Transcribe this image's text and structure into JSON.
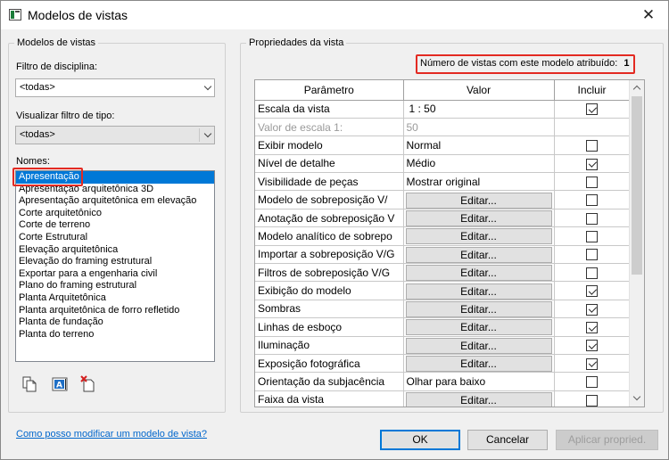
{
  "window": {
    "title": "Modelos de vistas",
    "close_glyph": "✕"
  },
  "left_panel": {
    "legend": "Modelos de vistas",
    "discipline_filter": {
      "label": "Filtro de disciplina:",
      "value": "<todas>"
    },
    "type_filter": {
      "label": "Visualizar filtro de tipo:",
      "value": "<todas>"
    },
    "names_label": "Nomes:",
    "names": [
      "Apresentação",
      "Apresentação arquitetônica 3D",
      "Apresentação arquitetônica em elevação",
      "Corte arquitetônico",
      "Corte de terreno",
      "Corte Estrutural",
      "Elevação arquitetônica",
      "Elevação do framing estrutural",
      "Exportar para a engenharia civil",
      "Plano do framing estrutural",
      "Planta Arquitetônica",
      "Planta arquitetônica de forro refletido",
      "Planta de fundação",
      "Planta do terreno"
    ],
    "selected_index": 0,
    "tool_icons": [
      "duplicate-icon",
      "rename-icon",
      "delete-icon"
    ],
    "tool_glyphs": {
      "rename": "A"
    }
  },
  "right_panel": {
    "legend": "Propriedades da vista",
    "count_label": "Número de vistas com este modelo atribuído:",
    "count_value": "1",
    "columns": {
      "param": "Parâmetro",
      "value": "Valor",
      "include": "Incluir"
    },
    "rows": [
      {
        "param": "Escala da vista",
        "value": "1 : 50",
        "type": "text",
        "include": true
      },
      {
        "param": "Valor de escala    1:",
        "value": "50",
        "type": "text",
        "include": null,
        "disabled": true
      },
      {
        "param": "Exibir modelo",
        "value": "Normal",
        "type": "text",
        "include": false
      },
      {
        "param": "Nível de detalhe",
        "value": "Médio",
        "type": "text",
        "include": true
      },
      {
        "param": "Visibilidade de peças",
        "value": "Mostrar original",
        "type": "text",
        "include": false
      },
      {
        "param": "Modelo de sobreposição V/",
        "value": "Editar...",
        "type": "button",
        "include": false
      },
      {
        "param": "Anotação de sobreposição V",
        "value": "Editar...",
        "type": "button",
        "include": false
      },
      {
        "param": "Modelo analítico de sobrepo",
        "value": "Editar...",
        "type": "button",
        "include": false
      },
      {
        "param": "Importar a sobreposição V/G",
        "value": "Editar...",
        "type": "button",
        "include": false
      },
      {
        "param": "Filtros de sobreposição V/G",
        "value": "Editar...",
        "type": "button",
        "include": false
      },
      {
        "param": "Exibição do modelo",
        "value": "Editar...",
        "type": "button",
        "include": true
      },
      {
        "param": "Sombras",
        "value": "Editar...",
        "type": "button",
        "include": true
      },
      {
        "param": "Linhas de esboço",
        "value": "Editar...",
        "type": "button",
        "include": true
      },
      {
        "param": "Iluminação",
        "value": "Editar...",
        "type": "button",
        "include": true
      },
      {
        "param": "Exposição fotográfica",
        "value": "Editar...",
        "type": "button",
        "include": true
      },
      {
        "param": "Orientação da subjacência",
        "value": "Olhar para baixo",
        "type": "text",
        "include": false
      },
      {
        "param": "Faixa da vista",
        "value": "Editar...",
        "type": "button",
        "include": false
      }
    ]
  },
  "footer": {
    "help_link": "Como posso modificar um modelo de vista?",
    "ok": "OK",
    "cancel": "Cancelar",
    "apply": "Aplicar propried."
  },
  "colors": {
    "accent": "#0078d7",
    "highlight": "#e32a22",
    "link": "#0066cc"
  }
}
